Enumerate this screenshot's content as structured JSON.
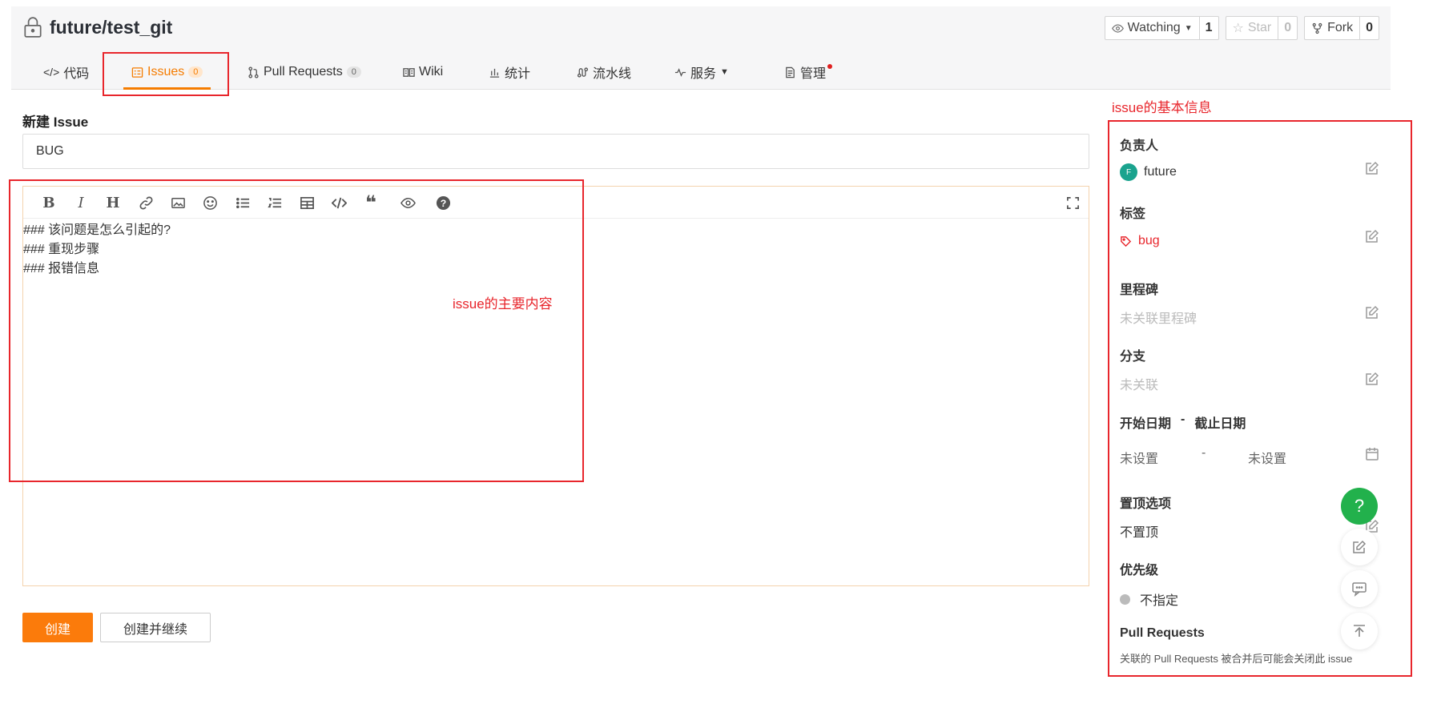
{
  "repo": {
    "name": "future/test_git"
  },
  "actions": {
    "watch": {
      "label": "Watching",
      "count": "1"
    },
    "star": {
      "label": "Star",
      "count": "0"
    },
    "fork": {
      "label": "Fork",
      "count": "0"
    }
  },
  "tabs": [
    {
      "label": "代码"
    },
    {
      "label": "Issues",
      "badge": "0"
    },
    {
      "label": "Pull Requests",
      "badge": "0"
    },
    {
      "label": "Wiki"
    },
    {
      "label": "统计"
    },
    {
      "label": "流水线"
    },
    {
      "label": "服务"
    },
    {
      "label": "管理"
    }
  ],
  "form": {
    "heading": "新建 Issue",
    "title_value": "BUG",
    "body_lines": [
      "### 该问题是怎么引起的?",
      "### 重现步骤",
      "### 报错信息"
    ],
    "create_label": "创建",
    "create_continue_label": "创建并继续"
  },
  "annotations": {
    "main_content": "issue的主要内容",
    "basic_info": "issue的基本信息"
  },
  "sidebar": {
    "assignee": {
      "head": "负责人",
      "value": "future",
      "avatar": "F"
    },
    "labels": {
      "head": "标签",
      "value": "bug"
    },
    "milestone": {
      "head": "里程碑",
      "value": "未关联里程碑"
    },
    "branch": {
      "head": "分支",
      "value": "未关联"
    },
    "dates": {
      "start_head": "开始日期",
      "sep": "-",
      "end_head": "截止日期",
      "start_value": "未设置",
      "end_value": "未设置"
    },
    "pin": {
      "head": "置顶选项",
      "value": "不置顶"
    },
    "priority": {
      "head": "优先级",
      "value": "不指定"
    },
    "pull_requests": {
      "head": "Pull Requests",
      "note": "关联的 Pull Requests 被合并后可能会关闭此 issue"
    }
  },
  "fab": {
    "help": "?"
  },
  "colors": {
    "accent": "#fb7b0b",
    "annotation": "#e8262c",
    "help": "#22b14c"
  }
}
